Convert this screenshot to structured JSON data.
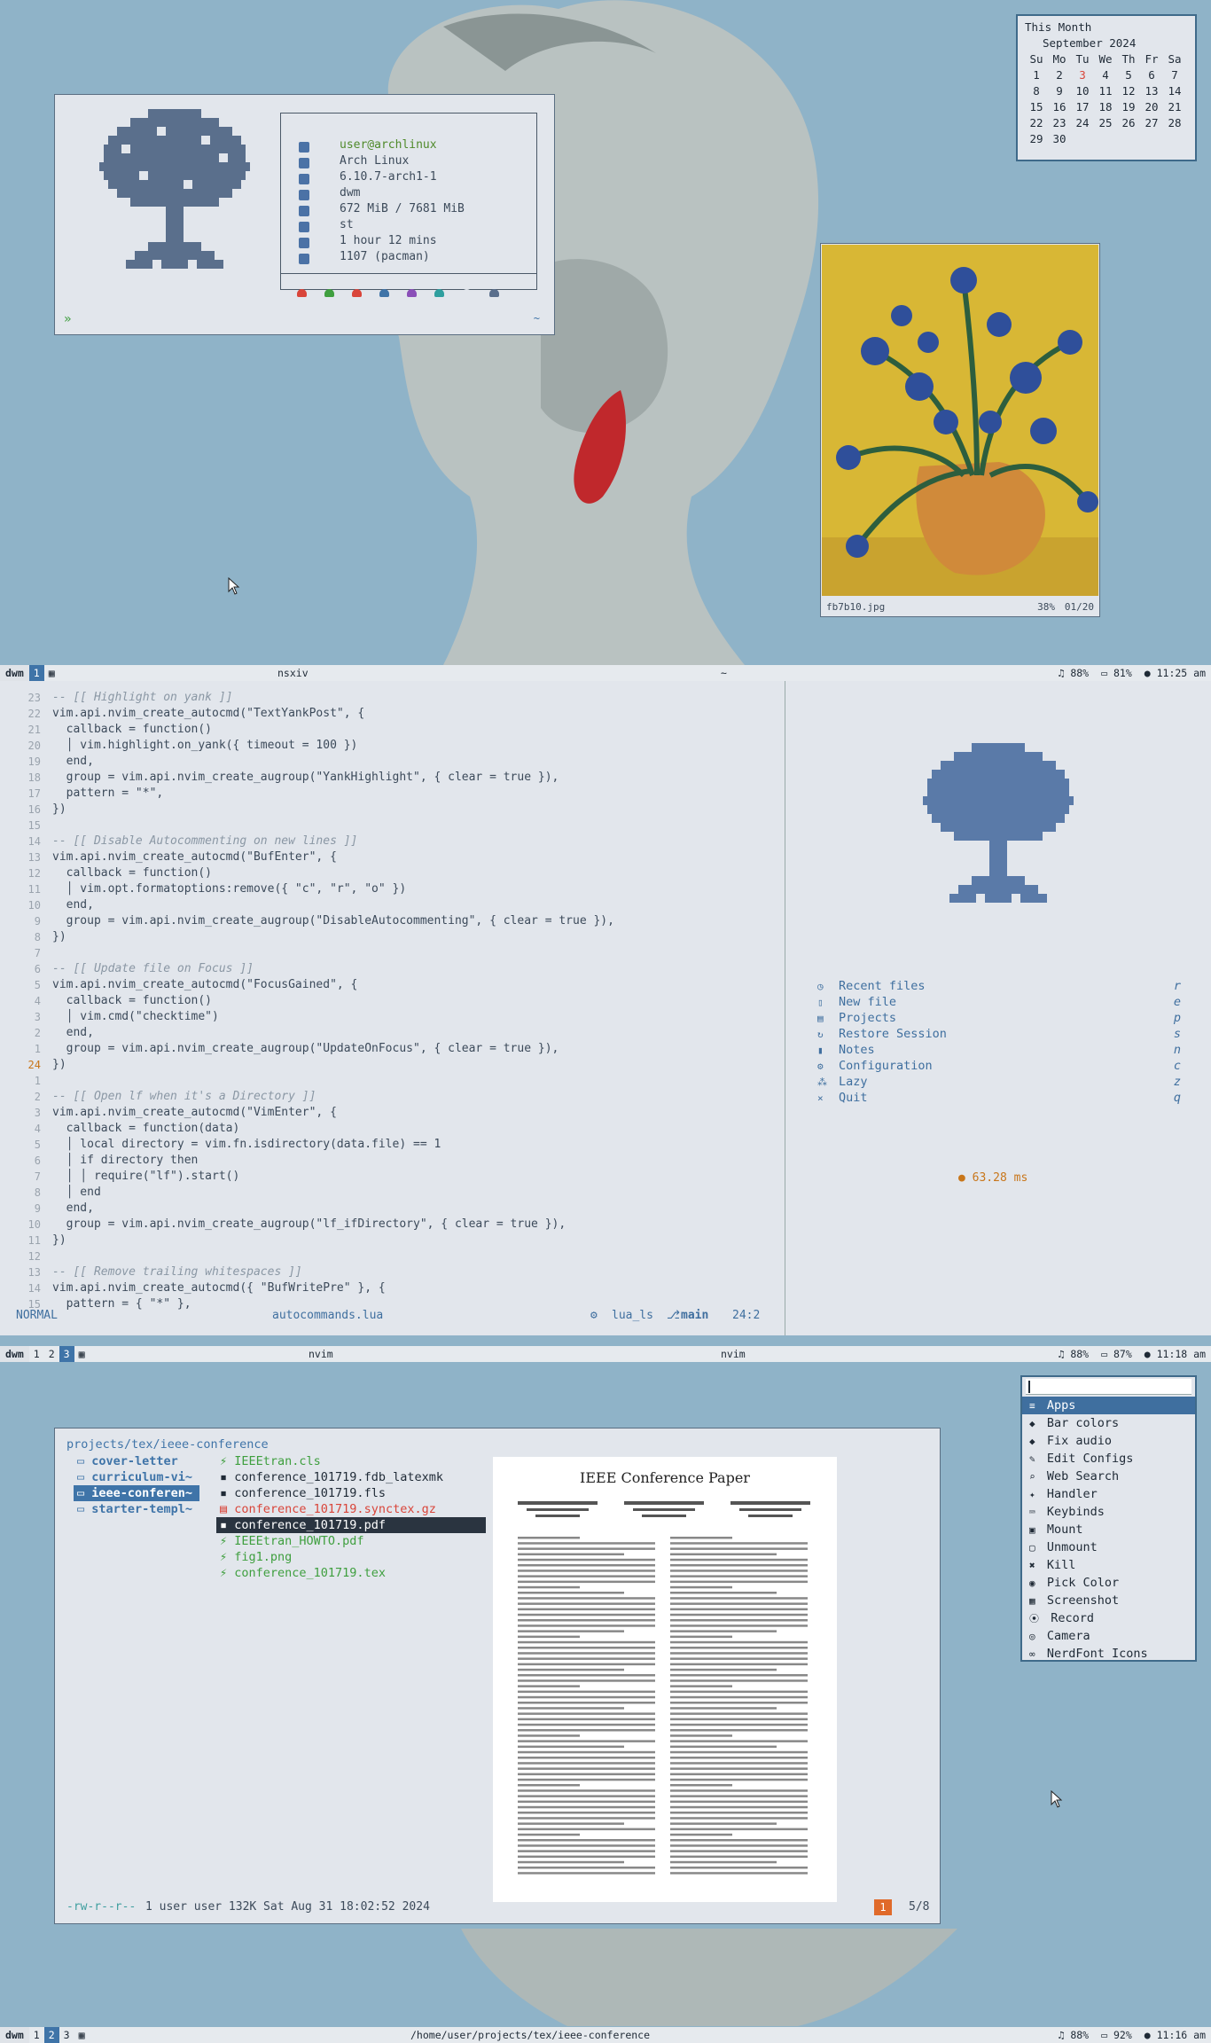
{
  "colors": {
    "desktop": "#8fb3c8",
    "window_bg": "#e2e6ec",
    "accent": "#3f74a8",
    "string": "#4f8a2a",
    "keyword": "#8a4fb8",
    "red_file": "#d9453a",
    "green_file": "#3f9f3f"
  },
  "fetch": {
    "user": "user@archlinux",
    "os": "Arch Linux",
    "kernel": "6.10.7-arch1-1",
    "wm": "dwm",
    "memory": "672 MiB / 7681 MiB",
    "terminal": "st",
    "uptime": "1 hour 12 mins",
    "packages": "1107 (pacman)",
    "prompt": "»",
    "cwd": "~"
  },
  "calendar": {
    "label": "This Month",
    "month": "September 2024",
    "weekdays": [
      "Su",
      "Mo",
      "Tu",
      "We",
      "Th",
      "Fr",
      "Sa"
    ],
    "rows": [
      [
        "1",
        "2",
        "3",
        "4",
        "5",
        "6",
        "7"
      ],
      [
        "8",
        "9",
        "10",
        "11",
        "12",
        "13",
        "14"
      ],
      [
        "15",
        "16",
        "17",
        "18",
        "19",
        "20",
        "21"
      ],
      [
        "22",
        "23",
        "24",
        "25",
        "26",
        "27",
        "28"
      ],
      [
        "29",
        "30",
        "",
        "",
        "",
        "",
        ""
      ]
    ],
    "today": "3"
  },
  "sxiv": {
    "filename": "fb7b10.jpg",
    "zoom": "38%",
    "index": "01/20"
  },
  "bar1": {
    "dwm": "dwm",
    "tags": [
      "1"
    ],
    "layout_icon": "tile-icon",
    "title_left": "nsxiv",
    "title_center": "~",
    "music": "♫ 88%",
    "battery": "81%",
    "time": "11:25 am"
  },
  "bar2": {
    "tags": [
      "1",
      "2",
      "3"
    ],
    "title_left": "nvim",
    "title_right": "nvim",
    "music": "♫ 88%",
    "battery": "87%",
    "time": "11:18 am"
  },
  "bar3": {
    "tags": [
      "1",
      "2",
      "3"
    ],
    "title": "/home/user/projects/tex/ieee-conference",
    "music": "♫ 88%",
    "battery": "92%",
    "time": "11:16 am"
  },
  "editor": {
    "lines": [
      {
        "n": "23",
        "t": "-- [[ Highlight on yank ]]",
        "cls": "c"
      },
      {
        "n": "22",
        "t": "vim.api.nvim_create_autocmd(\"TextYankPost\", {"
      },
      {
        "n": "21",
        "t": "  callback = function()"
      },
      {
        "n": "20",
        "t": "  │ vim.highlight.on_yank({ timeout = 100 })"
      },
      {
        "n": "19",
        "t": "  end,"
      },
      {
        "n": "18",
        "t": "  group = vim.api.nvim_create_augroup(\"YankHighlight\", { clear = true }),"
      },
      {
        "n": "17",
        "t": "  pattern = \"*\","
      },
      {
        "n": "16",
        "t": "})"
      },
      {
        "n": "15",
        "t": ""
      },
      {
        "n": "14",
        "t": "-- [[ Disable Autocommenting on new lines ]]",
        "cls": "c"
      },
      {
        "n": "13",
        "t": "vim.api.nvim_create_autocmd(\"BufEnter\", {"
      },
      {
        "n": "12",
        "t": "  callback = function()"
      },
      {
        "n": "11",
        "t": "  │ vim.opt.formatoptions:remove({ \"c\", \"r\", \"o\" })"
      },
      {
        "n": "10",
        "t": "  end,"
      },
      {
        "n": "9",
        "t": "  group = vim.api.nvim_create_augroup(\"DisableAutocommenting\", { clear = true }),"
      },
      {
        "n": "8",
        "t": "})"
      },
      {
        "n": "7",
        "t": ""
      },
      {
        "n": "6",
        "t": "-- [[ Update file on Focus ]]",
        "cls": "c"
      },
      {
        "n": "5",
        "t": "vim.api.nvim_create_autocmd(\"FocusGained\", {"
      },
      {
        "n": "4",
        "t": "  callback = function()"
      },
      {
        "n": "3",
        "t": "  │ vim.cmd(\"checktime\")"
      },
      {
        "n": "2",
        "t": "  end,"
      },
      {
        "n": "1",
        "t": "  group = vim.api.nvim_create_augroup(\"UpdateOnFocus\", { clear = true }),"
      },
      {
        "n": "24",
        "t": "})",
        "cur": true
      },
      {
        "n": "1",
        "t": ""
      },
      {
        "n": "2",
        "t": "-- [[ Open lf when it's a Directory ]]",
        "cls": "c"
      },
      {
        "n": "3",
        "t": "vim.api.nvim_create_autocmd(\"VimEnter\", {"
      },
      {
        "n": "4",
        "t": "  callback = function(data)"
      },
      {
        "n": "5",
        "t": "  │ local directory = vim.fn.isdirectory(data.file) == 1"
      },
      {
        "n": "6",
        "t": "  │ if directory then"
      },
      {
        "n": "7",
        "t": "  │ │ require(\"lf\").start()"
      },
      {
        "n": "8",
        "t": "  │ end"
      },
      {
        "n": "9",
        "t": "  end,"
      },
      {
        "n": "10",
        "t": "  group = vim.api.nvim_create_augroup(\"lf_ifDirectory\", { clear = true }),"
      },
      {
        "n": "11",
        "t": "})"
      },
      {
        "n": "12",
        "t": ""
      },
      {
        "n": "13",
        "t": "-- [[ Remove trailing whitespaces ]]",
        "cls": "c"
      },
      {
        "n": "14",
        "t": "vim.api.nvim_create_autocmd({ \"BufWritePre\" }, {"
      },
      {
        "n": "15",
        "t": "  pattern = { \"*\" },"
      }
    ],
    "mode": "NORMAL",
    "file": "autocommands.lua",
    "lsp": "lua_ls",
    "branch": "main",
    "pos": "24:2"
  },
  "dashboard": {
    "items": [
      {
        "icon": "clock-icon",
        "label": "Recent files",
        "key": "r"
      },
      {
        "icon": "file-icon",
        "label": "New file",
        "key": "e"
      },
      {
        "icon": "list-icon",
        "label": "Projects",
        "key": "p"
      },
      {
        "icon": "restore-icon",
        "label": "Restore Session",
        "key": "s"
      },
      {
        "icon": "notes-icon",
        "label": "Notes",
        "key": "n"
      },
      {
        "icon": "gear-icon",
        "label": "Configuration",
        "key": "c"
      },
      {
        "icon": "lazy-icon",
        "label": "Lazy",
        "key": "z"
      },
      {
        "icon": "close-icon",
        "label": "Quit",
        "key": "q"
      }
    ],
    "startup": "63.28 ms"
  },
  "lf": {
    "path": "projects/tex/ieee-conference",
    "dirs": [
      "cover-letter",
      "curriculum-vi~",
      "ieee-conferen~",
      "starter-templ~"
    ],
    "selected_dir": "ieee-conferen~",
    "files": [
      {
        "name": "IEEEtran.cls",
        "kind": "green"
      },
      {
        "name": "conference_101719.fdb_latexmk",
        "kind": "plain"
      },
      {
        "name": "conference_101719.fls",
        "kind": "plain"
      },
      {
        "name": "conference_101719.synctex.gz",
        "kind": "red"
      },
      {
        "name": "conference_101719.pdf",
        "kind": "selected"
      },
      {
        "name": "IEEEtran_HOWTO.pdf",
        "kind": "green"
      },
      {
        "name": "fig1.png",
        "kind": "green"
      },
      {
        "name": "conference_101719.tex",
        "kind": "green"
      }
    ],
    "perms": "-rw-r--r--",
    "info": "1 user user 132K Sat Aug 31 18:02:52 2024",
    "count_badge": "1",
    "index": "5/8",
    "pdf_title": "IEEE Conference Paper"
  },
  "launcher": {
    "items": [
      "Apps",
      "Bar colors",
      "Fix audio",
      "Edit Configs",
      "Web Search",
      "Handler",
      "Keybinds",
      "Mount",
      "Unmount",
      "Kill",
      "Pick Color",
      "Screenshot",
      "Record",
      "Camera",
      "NerdFont Icons"
    ],
    "selected": "Apps"
  }
}
